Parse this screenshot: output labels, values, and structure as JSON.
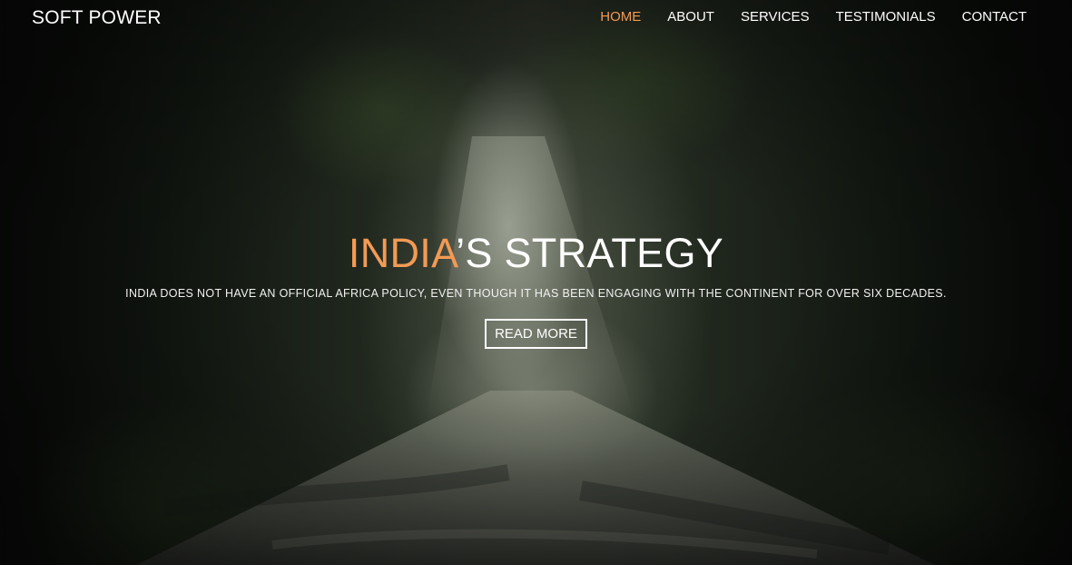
{
  "brand": {
    "logo_text": "SOFT POWER"
  },
  "nav": {
    "items": [
      {
        "label": "HOME",
        "active": true
      },
      {
        "label": "ABOUT",
        "active": false
      },
      {
        "label": "SERVICES",
        "active": false
      },
      {
        "label": "TESTIMONIALS",
        "active": false
      },
      {
        "label": "CONTACT",
        "active": false
      }
    ]
  },
  "hero": {
    "headline_accent": "INDIA",
    "headline_rest": "’S STRATEGY",
    "tagline": "INDIA DOES NOT HAVE AN OFFICIAL AFRICA POLICY, EVEN THOUGH IT HAS BEEN ENGAGING WITH THE CONTINENT FOR OVER SIX DECADES.",
    "cta_label": "READ MORE"
  },
  "colors": {
    "accent": "#f29a55",
    "text": "#ffffff"
  }
}
